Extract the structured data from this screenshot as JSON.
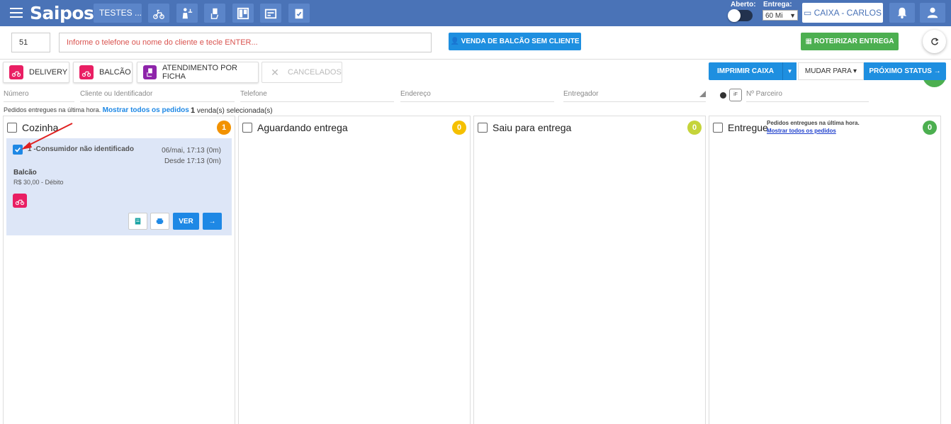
{
  "header": {
    "logo": "Saipos",
    "store": "TESTES ...",
    "aberto_label": "Aberto:",
    "entrega_label": "Entrega:",
    "entrega_value": "60 Mi",
    "caixa_label": "CAIXA - CARLOS"
  },
  "search": {
    "number_value": "51",
    "phone_placeholder": "Informe o telefone ou nome do cliente e tecle ENTER...",
    "venda_label": "VENDA DE BALCÃO SEM CLIENTE",
    "roteirizar_label": "ROTEIRIZAR ENTREGA"
  },
  "tabs": {
    "delivery": "DELIVERY",
    "balcao": "BALCÃO",
    "ficha": "ATENDIMENTO POR FICHA",
    "cancelados": "CANCELADOS"
  },
  "actions": {
    "imprimir": "IMPRIMIR CAIXA",
    "mudar": "MUDAR PARA",
    "proximo": "PRÓXIMO STATUS"
  },
  "filters": {
    "numero": "Número",
    "cliente": "Cliente ou Identificador",
    "telefone": "Telefone",
    "endereco": "Endereço",
    "entregador": "Entregador",
    "parceiro": "Nº Parceiro"
  },
  "info": {
    "text": "Pedidos entregues na última hora.",
    "link": "Mostrar todos os pedidos",
    "count": "1",
    "count_suffix": "venda(s) selecionada(s)"
  },
  "columns": [
    {
      "title": "Cozinha",
      "count": "1",
      "color": "#f29200"
    },
    {
      "title": "Aguardando entrega",
      "count": "0",
      "color": "#f5c000"
    },
    {
      "title": "Saiu para entrega",
      "count": "0",
      "color": "#c5d43a"
    },
    {
      "title": "Entregue",
      "count": "0",
      "color": "#4caf50",
      "note": "Pedidos entregues na última hora.",
      "note_link": "Mostrar todos os pedidos"
    }
  ],
  "order": {
    "name": "1 -Consumidor não identificado",
    "date": "06/mai, 17:13 (0m)",
    "since": "Desde 17:13 (0m)",
    "type": "Balcão",
    "price": "R$ 30,00 - Débito",
    "ver_label": "VER"
  }
}
